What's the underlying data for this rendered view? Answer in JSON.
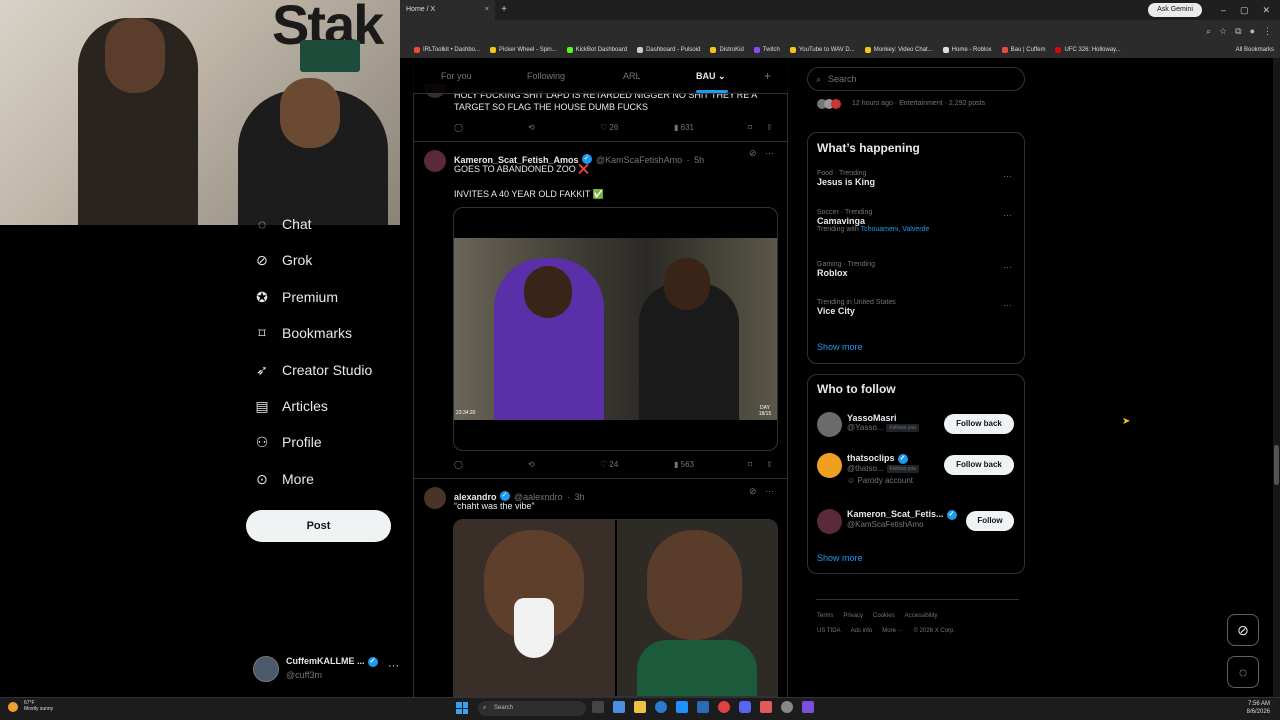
{
  "browser": {
    "active_tab_title": "Home / X",
    "new_tab_label": "+",
    "gemini_label": "Ask Gemini",
    "bookmarks": [
      "IRLToolkit • Dashbo...",
      "Picker Wheel - Spin...",
      "KickBot Dashboard",
      "Dashboard - Pulsoid",
      "DistroKid",
      "Twitch",
      "YouTube to WAV D...",
      "Monkey: Video Chat...",
      "Home - Roblox",
      "Bau | Cuffem",
      "UFC 326: Holloway..."
    ],
    "all_bookmarks_label": "All Bookmarks",
    "accent_color": "#e94b3c"
  },
  "nav": {
    "items": [
      {
        "label": "Chat",
        "icon": "chat-icon"
      },
      {
        "label": "Grok",
        "icon": "grok-icon"
      },
      {
        "label": "Premium",
        "icon": "premium-icon"
      },
      {
        "label": "Bookmarks",
        "icon": "bookmark-icon"
      },
      {
        "label": "Creator Studio",
        "icon": "rocket-icon"
      },
      {
        "label": "Articles",
        "icon": "article-icon"
      },
      {
        "label": "Profile",
        "icon": "person-icon"
      },
      {
        "label": "More",
        "icon": "more-circle-icon"
      }
    ],
    "post_label": "Post",
    "account": {
      "name": "CuffemKALLME ...",
      "handle": "@cuff3m"
    }
  },
  "timeline": {
    "tabs": [
      {
        "label": "For you"
      },
      {
        "label": "Following"
      },
      {
        "label": "ARL"
      },
      {
        "label": "BAU"
      }
    ],
    "add_tab": "+",
    "tweets": [
      {
        "text": "HOLY FUCKING SHIT LAPD IS RETARDED NIGGER NO SHIT THEY'RE A TARGET SO FLAG THE HOUSE DUMB FUCKS",
        "retweets": "",
        "likes": "26",
        "views": "631"
      },
      {
        "name": "Kameron_Scat_Fetish_Amos",
        "handle": "@KamScaFetishAmo",
        "time": "5h",
        "line1": "GOES TO ABANDONED ZOO ❌",
        "line2": "INVITES A 40 YEAR OLD FAKKIT ✅",
        "video_time": "23:34:20",
        "video_day": "DAY 18/15",
        "likes": "24",
        "views": "563"
      },
      {
        "name": "alexandro",
        "handle": "@aalexndro",
        "time": "3h",
        "text": "“chaht was the vibe”"
      }
    ]
  },
  "right": {
    "search_placeholder": "Search",
    "top_meta": "12 hours ago · Entertainment · 2,292 posts",
    "whats_happening_title": "What’s happening",
    "trends": [
      {
        "category": "Food · Trending",
        "name": "Jesus is King",
        "sub": "",
        "sub_links": ""
      },
      {
        "category": "Soccer · Trending",
        "name": "Camavinga",
        "sub": "Trending with",
        "sub_links": "Tchouameni, Valverde"
      },
      {
        "category": "Gaming · Trending",
        "name": "Roblox",
        "sub": "",
        "sub_links": ""
      },
      {
        "category": "Trending in United States",
        "name": "Vice City",
        "sub": "",
        "sub_links": ""
      }
    ],
    "show_more": "Show more",
    "who_to_follow_title": "Who to follow",
    "who_to_follow": [
      {
        "name": "YassoMasri",
        "handle": "@Yasso...",
        "follows_you": "Follows you",
        "extra": "",
        "button": "Follow back"
      },
      {
        "name": "thatsoclips",
        "handle": "@thatso...",
        "follows_you": "Follows you",
        "extra": "Parody account",
        "button": "Follow back"
      },
      {
        "name": "Kameron_Scat_Fetis...",
        "handle": "@KamScaFetishAmo",
        "follows_you": "",
        "extra": "",
        "button": "Follow"
      }
    ],
    "footer": {
      "row1": [
        "Terms",
        "Privacy",
        "Cookies",
        "Accessibility"
      ],
      "row2": [
        "US TIDA",
        "Ads info",
        "More ···",
        "© 2026 X Corp."
      ]
    }
  },
  "taskbar": {
    "weather_temp": "67°F",
    "weather_desc": "Mostly sunny",
    "search_label": "Search",
    "time": "7:56 AM",
    "date": "8/6/2026"
  }
}
